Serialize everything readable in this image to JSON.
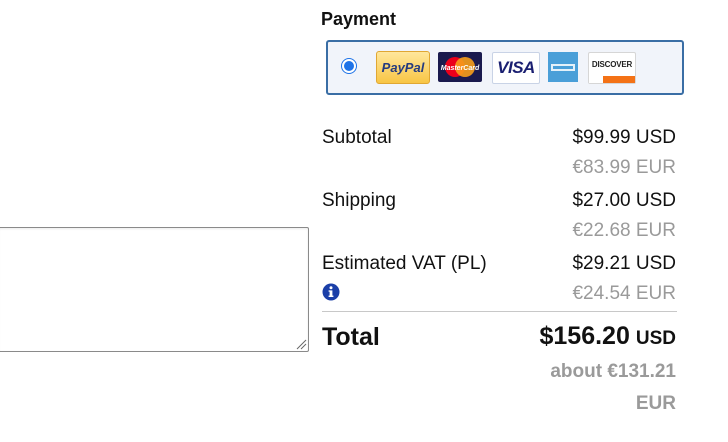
{
  "payment": {
    "title": "Payment",
    "logos": {
      "paypal": "PayPal",
      "mastercard": "MasterCard",
      "visa": "VISA",
      "discover": "DISCOVER"
    }
  },
  "summary": {
    "subtotal": {
      "label": "Subtotal",
      "usd": "$99.99 USD",
      "eur": "€83.99 EUR"
    },
    "shipping": {
      "label": "Shipping",
      "usd": "$27.00 USD",
      "eur": "€22.68 EUR"
    },
    "vat": {
      "label": "Estimated VAT (PL)",
      "usd": "$29.21 USD",
      "eur": "€24.54 EUR"
    },
    "total": {
      "label": "Total",
      "usd_amount": "$156.20",
      "usd_currency": "USD",
      "about_line1": "about €131.21",
      "about_line2": "EUR"
    }
  },
  "colors": {
    "accent": "#1e73e8",
    "border_blue": "#3a6ea5",
    "muted": "#9a9a9a"
  }
}
